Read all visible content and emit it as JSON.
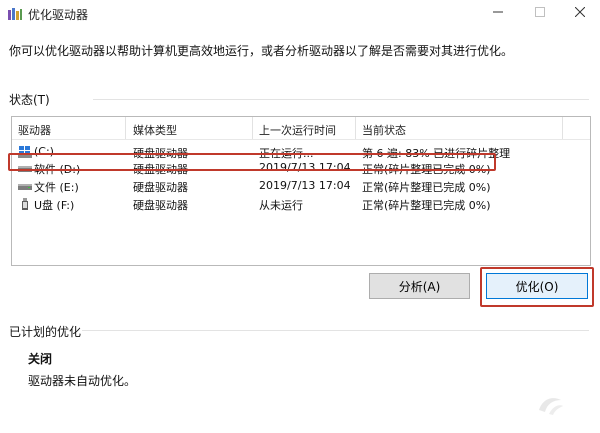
{
  "window": {
    "title": "优化驱动器"
  },
  "intro": "你可以优化驱动器以帮助计算机更高效地运行，或者分析驱动器以了解是否需要对其进行优化。",
  "status_section": {
    "label": "状态(T)"
  },
  "list": {
    "columns": [
      "驱动器",
      "媒体类型",
      "上一次运行时间",
      "当前状态"
    ],
    "rows": [
      {
        "drive": "(C:)",
        "media": "硬盘驱动器",
        "last_run": "正在运行...",
        "status": "第 6 遍: 83% 已进行碎片整理",
        "icon": "windows-drive-icon"
      },
      {
        "drive": "软件 (D:)",
        "media": "硬盘驱动器",
        "last_run": "2019/7/13 17:04",
        "status": "正常(碎片整理已完成 0%)",
        "icon": "hard-drive-icon"
      },
      {
        "drive": "文件 (E:)",
        "media": "硬盘驱动器",
        "last_run": "2019/7/13 17:04",
        "status": "正常(碎片整理已完成 0%)",
        "icon": "hard-drive-icon"
      },
      {
        "drive": "U盘 (F:)",
        "media": "硬盘驱动器",
        "last_run": "从未运行",
        "status": "正常(碎片整理已完成 0%)",
        "icon": "usb-drive-icon"
      }
    ]
  },
  "buttons": {
    "analyze": "分析(A)",
    "optimize": "优化(O)"
  },
  "scheduled_section": {
    "label": "已计划的优化",
    "state": "关闭",
    "description": "驱动器未自动优化。"
  },
  "colors": {
    "highlight": "#c0392b",
    "accent": "#0078d7"
  }
}
